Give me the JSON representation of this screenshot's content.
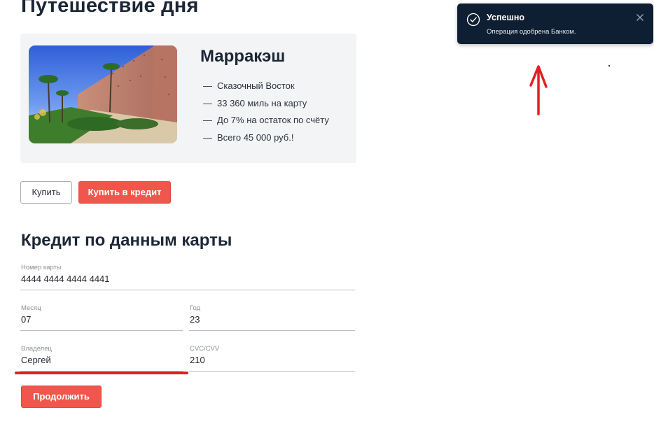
{
  "page": {
    "title": "Путешествие дня"
  },
  "offer": {
    "image_alt": "marrakesh-city-wall-photo",
    "city": "Марракэш",
    "features": [
      {
        "dash": "—",
        "text": "Сказочный Восток"
      },
      {
        "dash": "—",
        "text": "33 360 миль на карту"
      },
      {
        "dash": "—",
        "text": "До 7% на остаток по счёту"
      },
      {
        "dash": "—",
        "text": "Всего 45 000 руб.!"
      }
    ]
  },
  "actions": {
    "buy_label": "Купить",
    "buy_credit_label": "Купить в кредит"
  },
  "credit_form": {
    "title": "Кредит по данным карты",
    "card_number": {
      "label": "Номер карты",
      "value": "4444 4444 4444 4441"
    },
    "month": {
      "label": "Месяц",
      "value": "07"
    },
    "year": {
      "label": "Год",
      "value": "23"
    },
    "owner": {
      "label": "Владелец",
      "value": "Сергей"
    },
    "cvc": {
      "label": "CVC/CVV",
      "value": "210"
    },
    "continue_label": "Продолжить"
  },
  "notification": {
    "title": "Успешно",
    "message": "Операция одобрена Банком.",
    "icon": "check-circle-icon",
    "close_icon": "close-icon"
  },
  "colors": {
    "accent": "#f1564c",
    "toast_bg": "#0f1f33",
    "card_bg": "#f3f4f6",
    "annotation": "#e21f26"
  }
}
